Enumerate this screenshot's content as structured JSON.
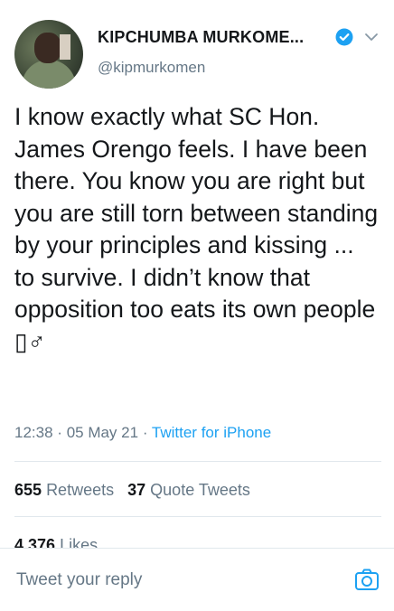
{
  "author": {
    "name": "KIPCHUMBA MURKOME...",
    "handle": "@kipmurkomen",
    "verified": true,
    "accent_color": "#1da1f2"
  },
  "tweet": {
    "text": "I know exactly what SC Hon. James Orengo feels. I have been there. You know you are right but you are still torn between standing by your principles and kissing ... to survive. I didn’t know that opposition too eats its own people ▯♂",
    "time": "12:38",
    "separator": "·",
    "date": "05 May 21",
    "source": "Twitter for iPhone"
  },
  "stats": {
    "retweets_count": "655",
    "retweets_label": "Retweets",
    "quotes_count": "37",
    "quotes_label": "Quote Tweets",
    "likes_count": "4,376",
    "likes_label": "Likes"
  },
  "reply": {
    "placeholder": "Tweet your reply"
  },
  "icons": {
    "verified": "verified-badge-icon",
    "menu": "chevron-down-icon",
    "camera": "camera-icon"
  }
}
